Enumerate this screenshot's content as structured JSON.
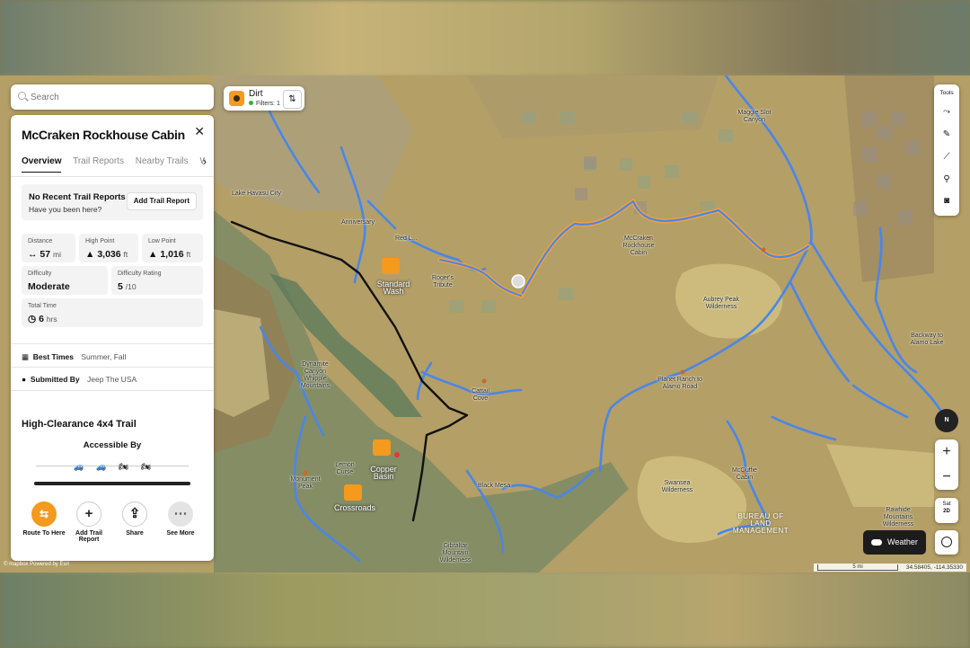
{
  "search": {
    "placeholder": "Search"
  },
  "trail": {
    "name": "McCraken Rockhouse Cabin",
    "tabs": [
      "Overview",
      "Trail Reports",
      "Nearby Trails",
      "W"
    ],
    "reports": {
      "heading": "No Recent Trail Reports",
      "subtext": "Have you been here?",
      "add_button": "Add Trail Report"
    },
    "stats": {
      "distance": {
        "label": "Distance",
        "value": "57",
        "unit": "mi"
      },
      "high_point": {
        "label": "High Point",
        "value": "3,036",
        "unit": "ft"
      },
      "low_point": {
        "label": "Low Point",
        "value": "1,016",
        "unit": "ft"
      },
      "difficulty": {
        "label": "Difficulty",
        "value": "Moderate"
      },
      "difficulty_rating": {
        "label": "Difficulty Rating",
        "value": "5",
        "unit": "/10"
      },
      "total_time": {
        "label": "Total Time",
        "value": "6",
        "unit": "hrs"
      }
    },
    "best_times": {
      "label": "Best Times",
      "value": "Summer, Fall"
    },
    "submitted_by": {
      "label": "Submitted By",
      "value": "Jeep The USA"
    },
    "type": "High-Clearance 4x4 Trail",
    "accessible_by": "Accessible By",
    "vehicle_icons": [
      "jeep-icon",
      "atv-icon",
      "motorcycle-icon",
      "dirtbike-icon"
    ],
    "actions": {
      "route": "Route To Here",
      "add_report": "Add Trail Report",
      "share": "Share",
      "more": "See More"
    }
  },
  "layer": {
    "name": "Dirt",
    "filters": "Filters: 1"
  },
  "tools": {
    "label": "Tools",
    "icons": [
      "route-icon",
      "draw-icon",
      "measure-icon",
      "pin-icon",
      "camera-icon"
    ]
  },
  "map_controls": {
    "compass": "N",
    "zoom_in": "+",
    "zoom_out": "−",
    "sat_label": "Sat",
    "mode": "2D",
    "weather": "Weather"
  },
  "scale": {
    "distance": "5 mi",
    "coords": "34.58405, -114.35330"
  },
  "attribution": "© mapbox  Powered by Esri",
  "map_labels": {
    "lake_havasu": "Lake Havasu City",
    "anniversary": "Anniversary",
    "red_lake": "Red L...",
    "standard_wash": "Standard Wash",
    "rogers_tribute": "Roger's Tribute",
    "mccraken_cabin": "McCraken Rockhouse Cabin",
    "maggie_slot": "Maggie Slot Canyon",
    "aubrey_peak": "Aubrey Peak Wilderness",
    "backway_alamo": "Backway to Alamo Lake",
    "planet_ranch": "Planet Ranch to Alamo Road",
    "cattail_cove": "Cattail Cove",
    "dynamite": "Dynamite Canyon Whipple Mountains",
    "lemon_curse": "Lemon Curse",
    "monument_peak": "Monument Peak",
    "copper_basin": "Copper Basin",
    "crossroads": "Crossroads",
    "black_mesa": "Black Mesa",
    "mcguffie_cabin": "McGuffie Cabin",
    "swansea": "Swansea Wilderness",
    "blm": "BUREAU OF LAND MANAGEMENT",
    "rawhide": "Rawhide Mountains Wilderness",
    "gibraltar": "Gibraltar Mountain Wilderness"
  },
  "colors": {
    "accent": "#f39a1f",
    "trail_blue": "#4a86e8",
    "highlight": "#f6a13a",
    "road": "#111111"
  }
}
